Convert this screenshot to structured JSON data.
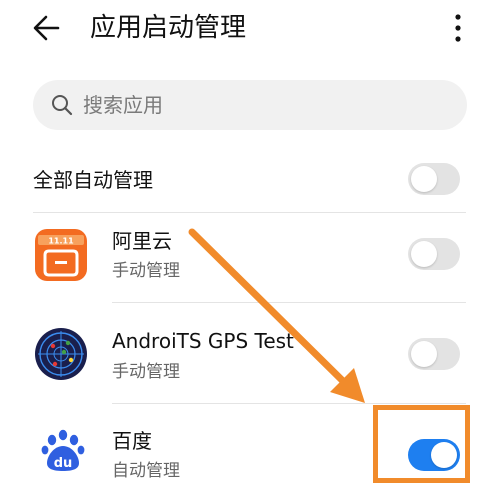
{
  "header": {
    "title": "应用启动管理",
    "back_icon": "arrow-left-icon",
    "more_icon": "more-vertical-icon"
  },
  "search": {
    "placeholder": "搜索应用",
    "value": "",
    "icon": "search-icon"
  },
  "all_auto": {
    "label": "全部自动管理",
    "enabled": false
  },
  "apps": [
    {
      "name": "阿里云",
      "status": "手动管理",
      "enabled": false,
      "icon": "aliyun-icon"
    },
    {
      "name": "AndroiTS GPS Test",
      "status": "手动管理",
      "enabled": false,
      "icon": "gps-radar-icon"
    },
    {
      "name": "百度",
      "status": "自动管理",
      "enabled": true,
      "icon": "baidu-paw-icon",
      "icon_text": "du"
    }
  ],
  "annotation": {
    "color": "#f18b2b"
  },
  "colors": {
    "toggle_on": "#1e7ff0",
    "toggle_off": "#e3e3e3",
    "aliyun": "#f36b21",
    "baidu": "#2f5fe0"
  }
}
